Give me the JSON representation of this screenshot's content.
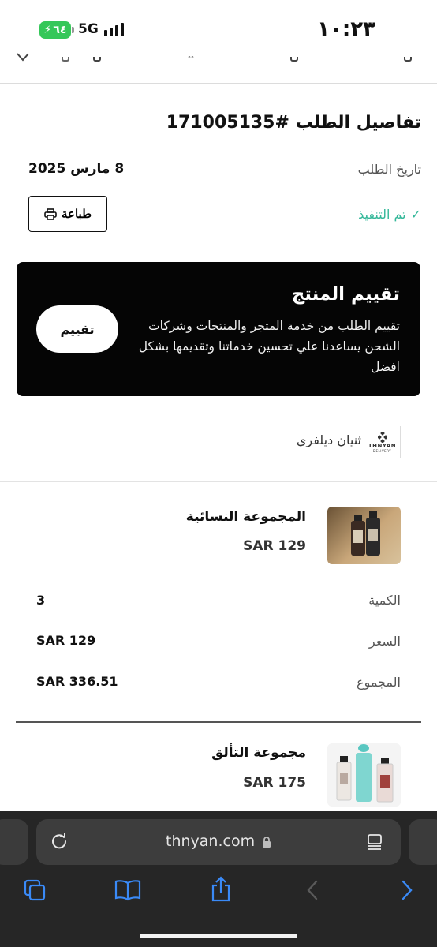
{
  "status_bar": {
    "time": "١٠:٢٣",
    "battery": "٦٤",
    "network": "5G"
  },
  "order": {
    "title": "تفاصيل الطلب #171005135",
    "date_label": "تاريخ الطلب",
    "date_value": "8 مارس 2025",
    "status": "تم التنفيذ",
    "print_label": "طباعة"
  },
  "rating_card": {
    "title": "تقييم المنتج",
    "description": "تقييم الطلب من خدمة المتجر والمنتجات وشركات الشحن يساعدنا علي تحسين خدماتنا وتقديمها بشكل افضل",
    "button": "تقييم"
  },
  "store": {
    "name": "ثنيان ديلفري",
    "logo_text": "THNYAN",
    "logo_sub": "DELIVERY"
  },
  "products": [
    {
      "name": "المجموعة النسائية",
      "price": "SAR 129"
    },
    {
      "name": "مجموعة التألق",
      "price": "SAR 175"
    }
  ],
  "details": {
    "quantity_label": "الكمية",
    "quantity_value": "3",
    "price_label": "السعر",
    "price_value": "SAR 129",
    "total_label": "المجموع",
    "total_value": "SAR 336.51"
  },
  "browser": {
    "url": "thnyan.com"
  },
  "colors": {
    "success": "#35b89a",
    "card_bg": "#050505",
    "browser_bar": "#262626",
    "ios_blue": "#3a8af7",
    "battery_green": "#35c759"
  }
}
